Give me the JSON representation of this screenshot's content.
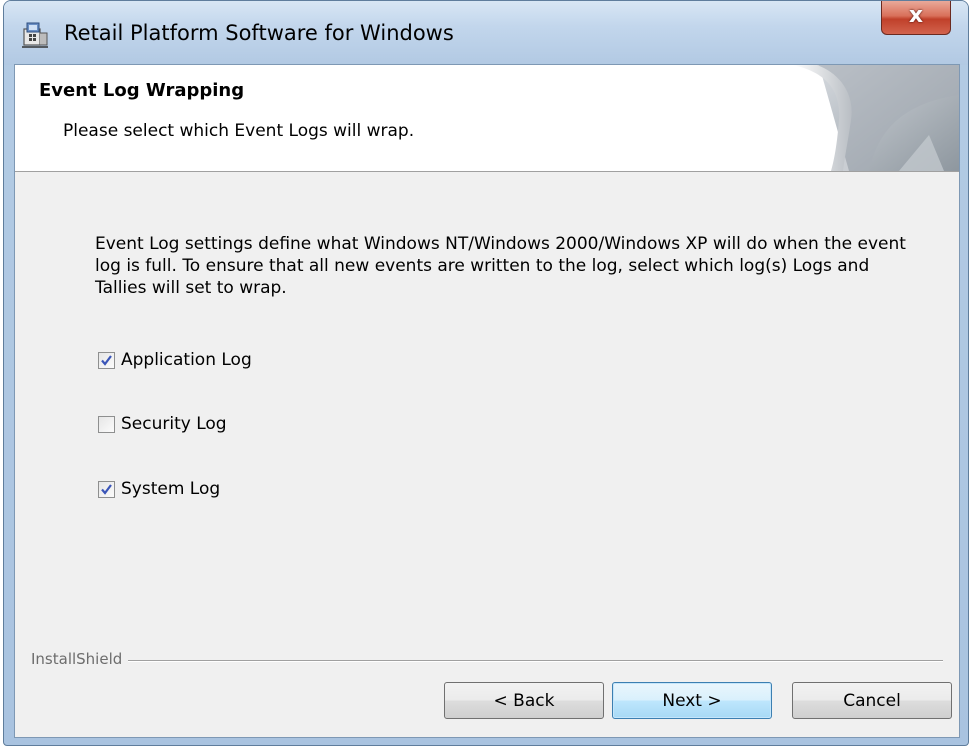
{
  "window": {
    "title": "Retail Platform Software for Windows",
    "close_label": "x"
  },
  "banner": {
    "title": "Event Log Wrapping",
    "subtitle": "Please select which Event Logs will wrap."
  },
  "content": {
    "description": "Event Log settings define what Windows NT/Windows 2000/Windows XP will do when the event log is full.  To ensure that all new events are written to the log, select which log(s) Logs and Tallies will set to wrap.",
    "options": [
      {
        "label": "Application Log",
        "checked": true
      },
      {
        "label": "Security Log",
        "checked": false
      },
      {
        "label": "System Log",
        "checked": true
      }
    ]
  },
  "footer": {
    "brand": "InstallShield",
    "back_label": "< Back",
    "next_label": "Next >",
    "cancel_label": "Cancel"
  },
  "colors": {
    "dialog_background": "#f0f0f0",
    "default_button": "#bee6fd",
    "close_button": "#c0402a"
  }
}
